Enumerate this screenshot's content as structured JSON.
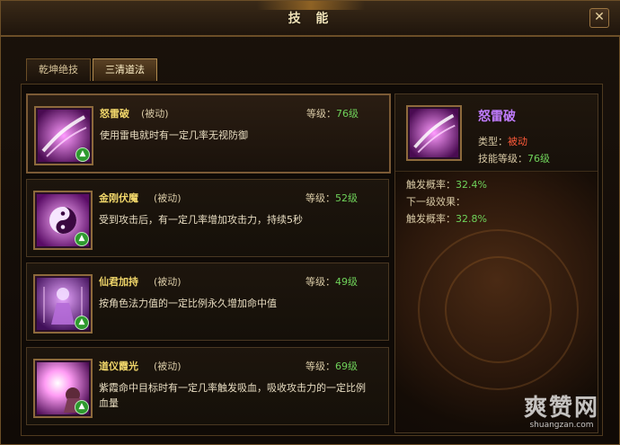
{
  "window": {
    "title": "技 能"
  },
  "tabs": [
    {
      "label": "乾坤绝技",
      "active": false
    },
    {
      "label": "三清道法",
      "active": true
    }
  ],
  "skills": [
    {
      "name": "怒雷破",
      "type": "(被动)",
      "level_label": "等级：",
      "level": "76级",
      "desc": "使用雷电就时有一定几率无视防御",
      "selected": true,
      "icon": "lightning-slash-icon"
    },
    {
      "name": "金刚伏魔",
      "type": "(被动)",
      "level_label": "等级：",
      "level": "52级",
      "desc": "受到攻击后，有一定几率增加攻击力，持续5秒",
      "selected": false,
      "icon": "yinyang-icon"
    },
    {
      "name": "仙君加持",
      "type": "(被动)",
      "level_label": "等级：",
      "level": "49级",
      "desc": "按角色法力值的一定比例永久增加命中值",
      "selected": false,
      "icon": "immortal-figure-icon"
    },
    {
      "name": "道仪霞光",
      "type": "(被动)",
      "level_label": "等级：",
      "level": "69级",
      "desc": "紫霞命中目标时有一定几率触发吸血，吸收攻击力的一定比例血量",
      "selected": false,
      "icon": "purple-glow-figure-icon"
    }
  ],
  "detail": {
    "name": "怒雷破",
    "type_label": "类型：",
    "type_value": "被动",
    "level_label": "技能等级：",
    "level_value": "76级",
    "trigger_label": "触发概率：",
    "trigger_value": "32.4%",
    "next_label": "下一级效果：",
    "next_trigger_label": "触发概率：",
    "next_trigger_value": "32.8%"
  },
  "watermark": {
    "big": "爽赞网",
    "small": "shuangzan.com"
  },
  "colors": {
    "gold_name": "#f0d66a",
    "green_value": "#6fd25a",
    "purple_name": "#c07cff",
    "red_type": "#ff5a3a"
  }
}
